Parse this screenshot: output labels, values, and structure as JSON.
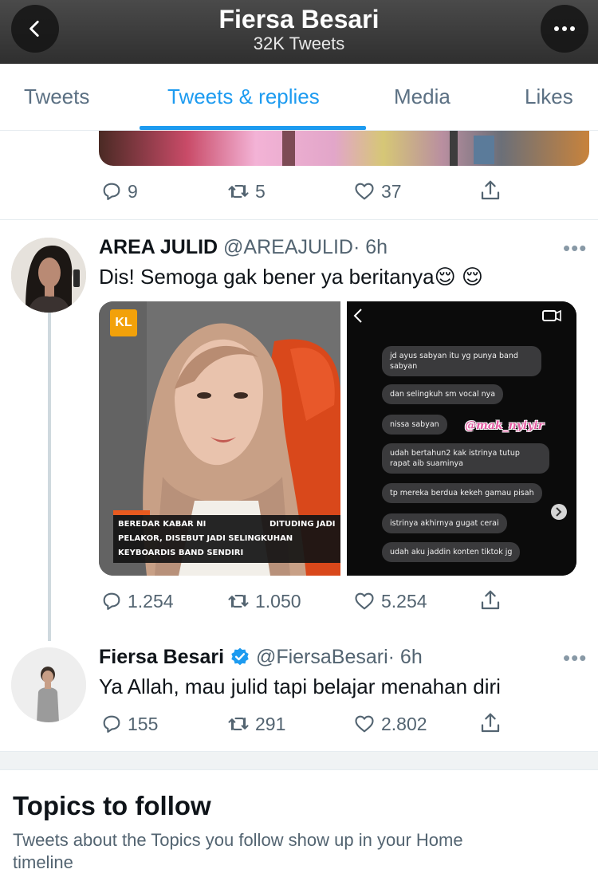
{
  "header": {
    "title": "Fiersa Besari",
    "subtitle": "32K Tweets"
  },
  "tabs": [
    {
      "label": "Tweets",
      "active": false
    },
    {
      "label": "Tweets & replies",
      "active": true
    },
    {
      "label": "Media",
      "active": false
    },
    {
      "label": "Likes",
      "active": false
    }
  ],
  "prev_tweet": {
    "replies": "9",
    "retweets": "5",
    "likes": "37"
  },
  "tweet1": {
    "name": "AREA JULID",
    "handle": "@AREAJULID",
    "time": "· 6h",
    "text": "Dis! Semoga gak bener ya beritanya😌 😌",
    "replies": "1.254",
    "retweets": "1.050",
    "likes": "5.254",
    "media_left": {
      "badge": "KL",
      "caption_line1_left": "BEREDAR KABAR NI",
      "caption_line1_right": "DITUDING JADI",
      "caption_line2": "PELAKOR, DISEBUT JADI SELINGKUHAN",
      "caption_line3": "KEYBOARDIS BAND SENDIRI"
    },
    "media_right": {
      "watermark": "@mak_nyiyir",
      "messages": [
        "jd ayus sabyan itu yg punya band sabyan",
        "dan selingkuh sm vocal nya",
        "nissa sabyan",
        "udah bertahun2 kak istrinya tutup rapat aib suaminya",
        "tp mereka berdua kekeh gamau pisah",
        "istrinya akhirnya gugat cerai",
        "udah aku jaddin konten tiktok jg"
      ]
    }
  },
  "tweet2": {
    "name": "Fiersa Besari",
    "handle": "@FiersaBesari",
    "time": "· 6h",
    "text": "Ya Allah, mau julid tapi belajar menahan diri",
    "replies": "155",
    "retweets": "291",
    "likes": "2.802"
  },
  "topics": {
    "title": "Topics to follow",
    "description": "Tweets about the Topics you follow show up in your Home timeline"
  },
  "colors": {
    "accent": "#1d9bf0",
    "muted": "#536471",
    "verified": "#1d9bf0"
  }
}
